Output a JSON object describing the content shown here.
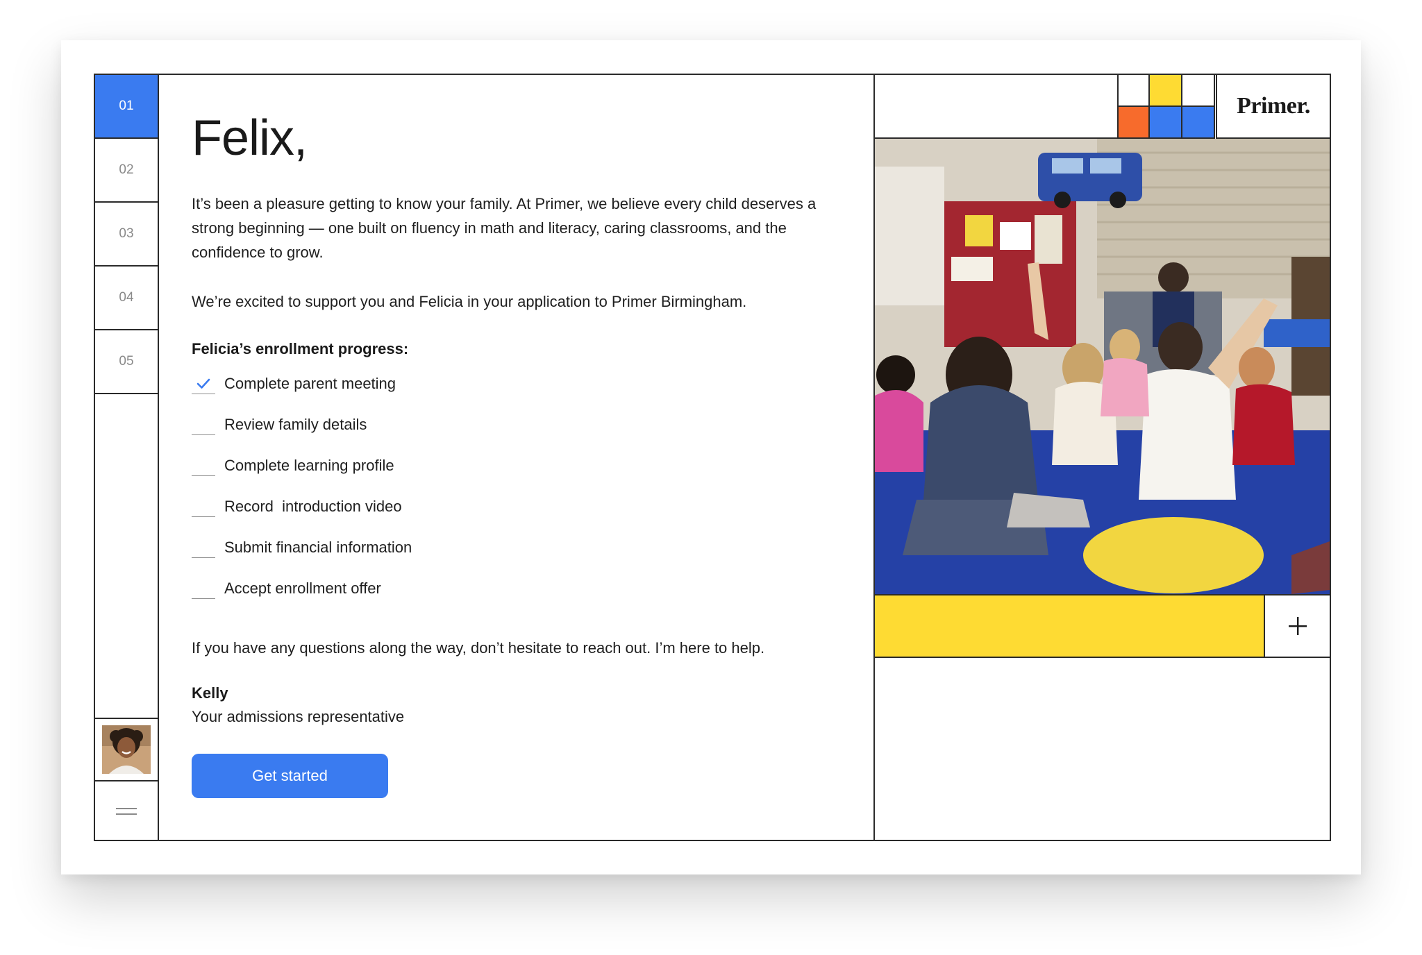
{
  "steps": [
    {
      "label": "01"
    },
    {
      "label": "02"
    },
    {
      "label": "03"
    },
    {
      "label": "04"
    },
    {
      "label": "05"
    }
  ],
  "letter": {
    "greeting": "Felix,",
    "intro": "It’s been a pleasure getting to know your family. At Primer, we believe every child deserves a strong beginning — one built on fluency in math and literacy, caring classrooms, and the confidence to grow.",
    "support": "We’re excited to support you and Felicia in your application to Primer Birmingham.",
    "progress_title": "Felicia’s enrollment progress:",
    "checklist": [
      {
        "label": "Complete parent meeting",
        "done": true
      },
      {
        "label": "Review family details",
        "done": false
      },
      {
        "label": "Complete learning profile",
        "done": false
      },
      {
        "label": "Record  introduction video",
        "done": false
      },
      {
        "label": "Submit financial information",
        "done": false
      },
      {
        "label": "Accept enrollment offer",
        "done": false
      }
    ],
    "closing": "If you have any questions along the way, don’t hesitate to reach out. I’m here to help.",
    "signer_name": "Kelly",
    "signer_role": "Your admissions representative",
    "cta_label": "Get started"
  },
  "brand": {
    "logo_text": "Primer.",
    "accent_blue": "#3a7bf0",
    "accent_yellow": "#fedb33",
    "accent_orange": "#f76b2c"
  },
  "icons": {
    "check": "check-icon",
    "plus": "plus-icon",
    "menu": "menu-icon"
  }
}
